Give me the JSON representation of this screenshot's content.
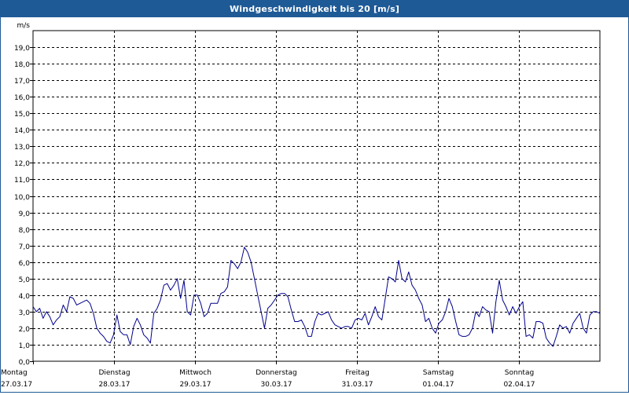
{
  "window": {
    "title": "Windgeschwindigkeit bis 20 [m/s]"
  },
  "colors": {
    "titlebar": "#1e5a96",
    "line": "#00008b",
    "grid": "#000000"
  },
  "chart_data": {
    "type": "line",
    "title": "Windgeschwindigkeit bis 20 [m/s]",
    "ylabel": "m/s",
    "ylim": [
      0,
      20
    ],
    "yticks": [
      "0,0",
      "1,0",
      "2,0",
      "3,0",
      "4,0",
      "5,0",
      "6,0",
      "7,0",
      "8,0",
      "9,0",
      "10,0",
      "11,0",
      "12,0",
      "13,0",
      "14,0",
      "15,0",
      "16,0",
      "17,0",
      "18,0",
      "19,0"
    ],
    "xlim": [
      0,
      7
    ],
    "grid": true,
    "x_labels": [
      {
        "day": "Montag",
        "date": "27.03.17"
      },
      {
        "day": "Dienstag",
        "date": "28.03.17"
      },
      {
        "day": "Mittwoch",
        "date": "29.03.17"
      },
      {
        "day": "Donnerstag",
        "date": "30.03.17"
      },
      {
        "day": "Freitag",
        "date": "31.03.17"
      },
      {
        "day": "Samstag",
        "date": "01.04.17"
      },
      {
        "day": "Sonntag",
        "date": "02.04.17"
      }
    ],
    "series": [
      {
        "values": [
          3.3,
          3.0,
          3.2,
          2.6,
          3.0,
          2.7,
          2.2,
          2.5,
          2.7,
          3.4,
          3.0,
          3.9,
          3.8,
          3.4,
          3.5,
          3.6,
          3.7,
          3.5,
          2.9,
          2.0,
          1.7,
          1.5,
          1.2,
          1.1,
          1.6,
          2.8,
          1.8,
          1.6,
          1.6,
          1.0,
          2.1,
          2.6,
          2.2,
          1.6,
          1.4,
          1.1,
          2.9,
          3.2,
          3.7,
          4.6,
          4.7,
          4.3,
          4.6,
          5.0,
          3.8,
          4.9,
          3.0,
          2.8,
          4.0,
          4.0,
          3.5,
          2.7,
          2.9,
          3.5,
          3.5,
          3.5,
          4.1,
          4.2,
          4.5,
          6.1,
          5.9,
          5.6,
          6.0,
          6.9,
          6.6,
          6.0,
          5.0,
          4.0,
          3.0,
          2.0,
          3.2,
          3.4,
          3.7,
          4.0,
          4.1,
          4.1,
          3.9,
          3.1,
          2.4,
          2.4,
          2.5,
          2.1,
          1.5,
          1.5,
          2.4,
          2.9,
          2.8,
          2.9,
          3.0,
          2.5,
          2.2,
          2.1,
          2.0,
          2.1,
          2.1,
          2.0,
          2.5,
          2.6,
          2.5,
          2.9,
          2.2,
          2.7,
          3.3,
          2.7,
          2.5,
          3.8,
          5.1,
          5.0,
          4.8,
          6.1,
          5.0,
          4.8,
          5.4,
          4.6,
          4.3,
          3.8,
          3.4,
          2.4,
          2.6,
          2.0,
          1.7,
          2.3,
          2.5,
          3.0,
          3.8,
          3.3,
          2.4,
          1.6,
          1.5,
          1.5,
          1.6,
          2.0,
          3.0,
          2.7,
          3.3,
          3.1,
          3.0,
          1.7,
          3.6,
          4.9,
          3.7,
          3.3,
          2.8,
          3.3,
          2.9,
          3.3,
          3.6,
          1.5,
          1.6,
          1.4,
          2.4,
          2.4,
          2.3,
          1.4,
          1.1,
          0.9,
          1.5,
          2.2,
          2.0,
          2.1,
          1.7,
          2.3,
          2.6,
          2.9,
          2.0,
          1.7,
          2.8,
          3.0,
          3.0,
          2.9
        ]
      }
    ]
  }
}
